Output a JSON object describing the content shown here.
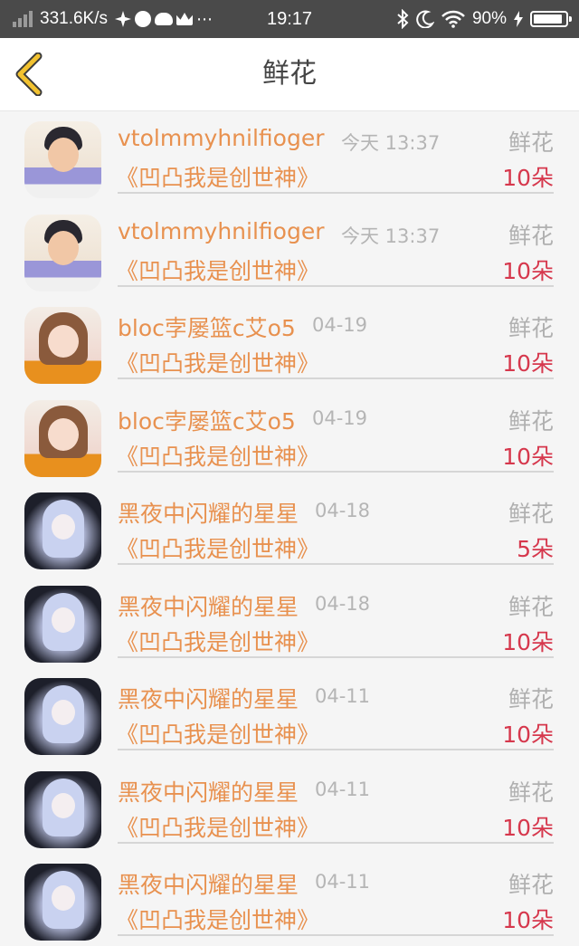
{
  "status_bar": {
    "speed": "331.6K/s",
    "time": "19:17",
    "battery": "90%",
    "battery_level": 0.9,
    "icons": [
      "signal-icon",
      "fan-icon",
      "planet-icon",
      "cloud-icon",
      "crown-icon",
      "more-icon",
      "bluetooth-icon",
      "moon-icon",
      "wifi-icon",
      "charging-icon",
      "battery-icon"
    ]
  },
  "nav": {
    "title": "鲜花",
    "back_icon": "chevron-left-icon"
  },
  "colors": {
    "name": "#e8914f",
    "count": "#d6384d",
    "muted": "#b5b5b5"
  },
  "items": [
    {
      "avatar": "boy",
      "name": "vtolmmyhnilfioger",
      "time": "今天 13:37",
      "gift": "鲜花",
      "book": "《凹凸我是创世神》",
      "count": "10朵"
    },
    {
      "avatar": "boy",
      "name": "vtolmmyhnilfioger",
      "time": "今天 13:37",
      "gift": "鲜花",
      "book": "《凹凸我是创世神》",
      "count": "10朵"
    },
    {
      "avatar": "girl",
      "name": "bloc孛屡篮c艾o5",
      "time": "04-19",
      "gift": "鲜花",
      "book": "《凹凸我是创世神》",
      "count": "10朵"
    },
    {
      "avatar": "girl",
      "name": "bloc孛屡篮c艾o5",
      "time": "04-19",
      "gift": "鲜花",
      "book": "《凹凸我是创世神》",
      "count": "10朵"
    },
    {
      "avatar": "anime",
      "name": "黑夜中闪耀的星星",
      "time": "04-18",
      "gift": "鲜花",
      "book": "《凹凸我是创世神》",
      "count": "5朵"
    },
    {
      "avatar": "anime",
      "name": "黑夜中闪耀的星星",
      "time": "04-18",
      "gift": "鲜花",
      "book": "《凹凸我是创世神》",
      "count": "10朵"
    },
    {
      "avatar": "anime",
      "name": "黑夜中闪耀的星星",
      "time": "04-11",
      "gift": "鲜花",
      "book": "《凹凸我是创世神》",
      "count": "10朵"
    },
    {
      "avatar": "anime",
      "name": "黑夜中闪耀的星星",
      "time": "04-11",
      "gift": "鲜花",
      "book": "《凹凸我是创世神》",
      "count": "10朵"
    },
    {
      "avatar": "anime",
      "name": "黑夜中闪耀的星星",
      "time": "04-11",
      "gift": "鲜花",
      "book": "《凹凸我是创世神》",
      "count": "10朵"
    }
  ]
}
